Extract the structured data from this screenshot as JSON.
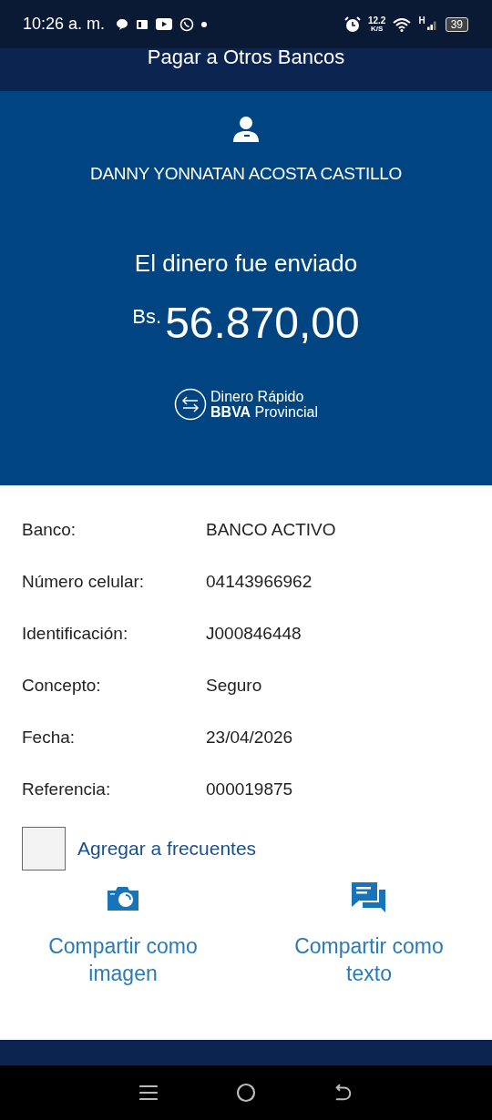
{
  "status_bar": {
    "time": "10:26 a. m.",
    "speed_value": "12.2",
    "speed_unit": "K/S",
    "network": "H",
    "battery": "39"
  },
  "header": {
    "title": "Pagar a Otros Bancos"
  },
  "receipt": {
    "recipient": "DANNY YONNATAN ACOSTA CASTILLO",
    "message": "El dinero fue enviado",
    "currency": "Bs.",
    "amount": "56.870,00",
    "logo_line_1": "Dinero Rápido",
    "logo_line_2": "**BBVA** Provincial"
  },
  "details": [
    {
      "label": "Banco:",
      "value": "BANCO ACTIVO"
    },
    {
      "label": "Número celular:",
      "value": "04143966962"
    },
    {
      "label": "Identificación:",
      "value": "J000846448"
    },
    {
      "label": "Concepto:",
      "value": "Seguro"
    },
    {
      "label": "Fecha:",
      "value": "23/04/2026"
    },
    {
      "label": "Referencia:",
      "value": "000019875"
    }
  ],
  "favorite": {
    "label": "Agregar a frecuentes",
    "checked": false
  },
  "share_actions": [
    {
      "kind": "image",
      "label": "Compartir como imagen"
    },
    {
      "kind": "text",
      "label": "Compartir como texto"
    }
  ]
}
